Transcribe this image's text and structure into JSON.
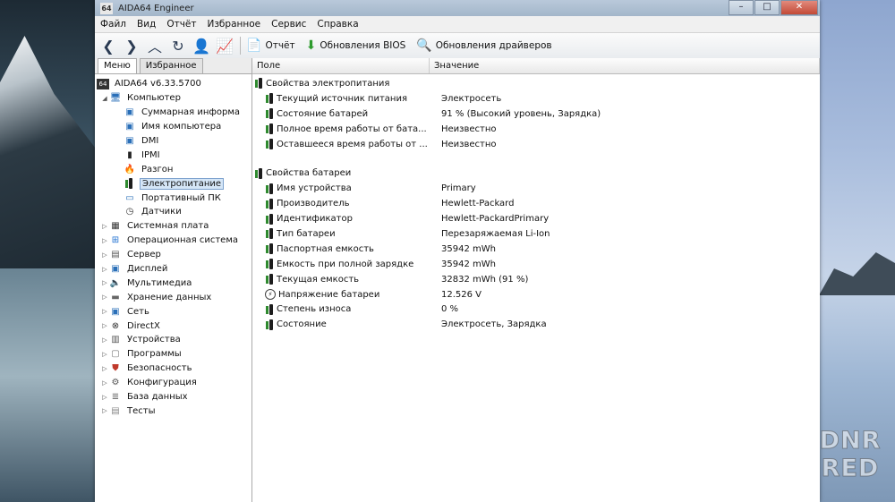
{
  "window": {
    "title": "AIDA64 Engineer",
    "icon_text": "64",
    "controls": [
      "–",
      "□",
      "✕"
    ]
  },
  "menu": [
    "Файл",
    "Вид",
    "Отчёт",
    "Избранное",
    "Сервис",
    "Справка"
  ],
  "toolbar": {
    "report_label": "Отчёт",
    "bios_label": "Обновления BIOS",
    "drivers_label": "Обновления драйверов"
  },
  "left_tabs": [
    "Меню",
    "Избранное"
  ],
  "tree": {
    "root": "AIDA64 v6.33.5700",
    "computer": "Компьютер",
    "computer_children": [
      "Суммарная информа",
      "Имя компьютера",
      "DMI",
      "IPMI",
      "Разгон",
      "Электропитание",
      "Портативный ПК",
      "Датчики"
    ],
    "categories": [
      "Системная плата",
      "Операционная система",
      "Сервер",
      "Дисплей",
      "Мультимедиа",
      "Хранение данных",
      "Сеть",
      "DirectX",
      "Устройства",
      "Программы",
      "Безопасность",
      "Конфигурация",
      "База данных",
      "Тесты"
    ]
  },
  "columns": {
    "field": "Поле",
    "value": "Значение"
  },
  "power": {
    "group": "Свойства электропитания",
    "rows": [
      {
        "field": "Текущий источник питания",
        "value": "Электросеть"
      },
      {
        "field": "Состояние батарей",
        "value": "91 % (Высокий уровень, Зарядка)"
      },
      {
        "field": "Полное время работы от бата...",
        "value": "Неизвестно"
      },
      {
        "field": "Оставшееся время работы от ...",
        "value": "Неизвестно"
      }
    ]
  },
  "battery": {
    "group": "Свойства батареи",
    "rows": [
      {
        "field": "Имя устройства",
        "value": "Primary"
      },
      {
        "field": "Производитель",
        "value": "Hewlett-Packard"
      },
      {
        "field": "Идентификатор",
        "value": "Hewlett-PackardPrimary"
      },
      {
        "field": "Тип батареи",
        "value": "Перезаряжаемая Li-Ion"
      },
      {
        "field": "Паспортная емкость",
        "value": "35942 mWh"
      },
      {
        "field": "Емкость при полной зарядке",
        "value": "35942 mWh"
      },
      {
        "field": "Текущая емкость",
        "value": "32832 mWh  (91 %)"
      },
      {
        "field": "Напряжение батареи",
        "value": "12.526 V"
      },
      {
        "field": "Степень износа",
        "value": "0 %"
      },
      {
        "field": "Состояние",
        "value": "Электросеть, Зарядка"
      }
    ]
  },
  "watermark": [
    "DNR",
    "RED"
  ]
}
